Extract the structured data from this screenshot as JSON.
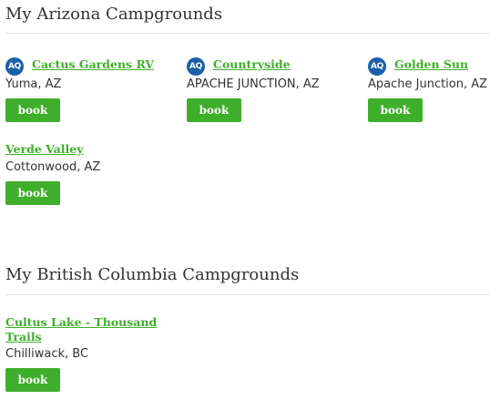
{
  "sections": [
    {
      "title": "My Arizona Campgrounds",
      "campgrounds": [
        {
          "name": "Cactus Gardens RV",
          "location": "Yuma, AZ",
          "badge": "AQ",
          "book_label": "book"
        },
        {
          "name": "Countryside",
          "location": "APACHE JUNCTION, AZ",
          "badge": "AQ",
          "book_label": "book"
        },
        {
          "name": "Golden Sun",
          "location": "Apache Junction, AZ",
          "badge": "AQ",
          "book_label": "book"
        },
        {
          "name": "Verde Valley",
          "location": "Cottonwood, AZ",
          "badge": "",
          "book_label": "book"
        }
      ]
    },
    {
      "title": "My British Columbia Campgrounds",
      "campgrounds": [
        {
          "name": "Cultus Lake - Thousand Trails",
          "location": "Chilliwack, BC",
          "badge": "",
          "book_label": "book"
        }
      ]
    }
  ],
  "colors": {
    "link_green": "#3fae2a",
    "button_green": "#3fae2a",
    "badge_blue": "#1b5fa8",
    "text": "#333333",
    "divider": "#e3e3e3"
  }
}
